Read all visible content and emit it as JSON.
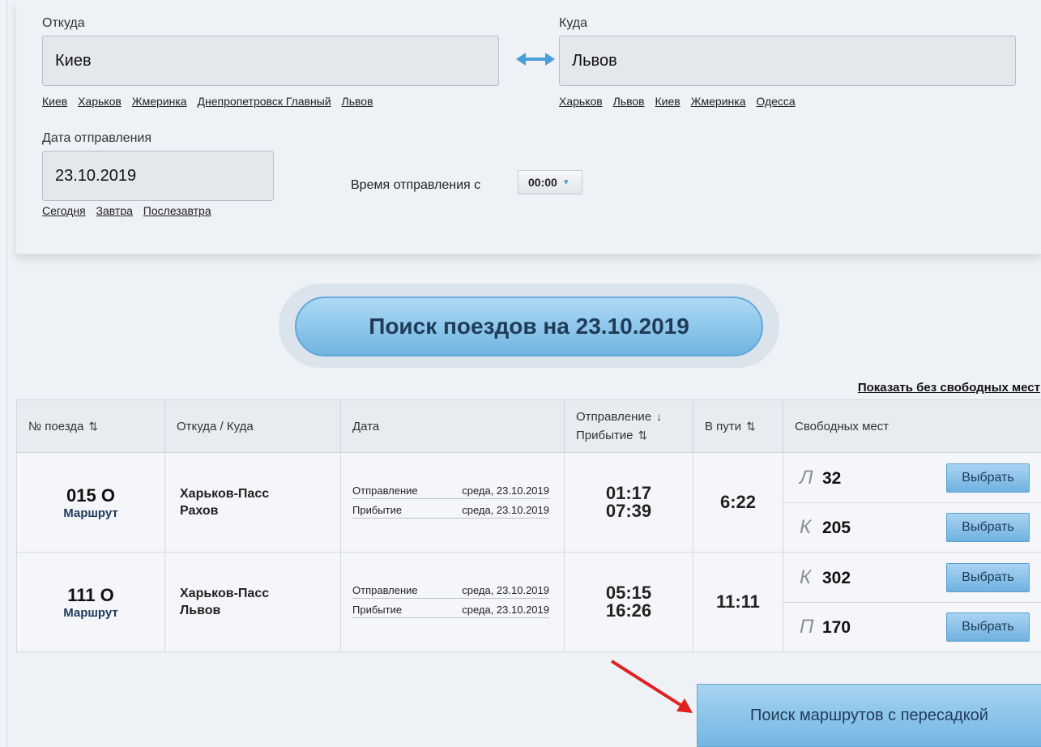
{
  "from": {
    "label": "Откуда",
    "value": "Киев",
    "quick_links": [
      "Киев",
      "Харьков",
      "Жмеринка",
      "Днепропетровск Главный",
      "Львов"
    ]
  },
  "to": {
    "label": "Куда",
    "value": "Львов",
    "quick_links": [
      "Харьков",
      "Львов",
      "Киев",
      "Жмеринка",
      "Одесса"
    ]
  },
  "date": {
    "label": "Дата отправления",
    "value": "23.10.2019",
    "quick_links": [
      "Сегодня",
      "Завтра",
      "Послезавтра"
    ]
  },
  "time": {
    "label": "Время отправления с",
    "value": "00:00"
  },
  "search_button": "Поиск поездов на 23.10.2019",
  "show_without_free": "Показать без свободных мест",
  "table": {
    "headers": {
      "train": "№ поезда",
      "route": "Откуда / Куда",
      "date": "Дата",
      "departure": "Отправление",
      "arrival": "Прибытие",
      "duration": "В пути",
      "seats": "Свободных мест"
    },
    "rows": [
      {
        "train": "015 О",
        "route_link": "Маршрут",
        "from": "Харьков-Пасс",
        "to": "Рахов",
        "dep_label": "Отправление",
        "dep_date": "среда, 23.10.2019",
        "arr_label": "Прибытие",
        "arr_date": "среда, 23.10.2019",
        "dep_time": "01:17",
        "arr_time": "07:39",
        "duration": "6:22",
        "seats": [
          {
            "type": "Л",
            "count": "32",
            "button": "Выбрать"
          },
          {
            "type": "К",
            "count": "205",
            "button": "Выбрать"
          }
        ]
      },
      {
        "train": "111 О",
        "route_link": "Маршрут",
        "from": "Харьков-Пасс",
        "to": "Львов",
        "dep_label": "Отправление",
        "dep_date": "среда, 23.10.2019",
        "arr_label": "Прибытие",
        "arr_date": "среда, 23.10.2019",
        "dep_time": "05:15",
        "arr_time": "16:26",
        "duration": "11:11",
        "seats": [
          {
            "type": "К",
            "count": "302",
            "button": "Выбрать"
          },
          {
            "type": "П",
            "count": "170",
            "button": "Выбрать"
          }
        ]
      }
    ]
  },
  "transfer_button": "Поиск маршрутов с пересадкой",
  "colors": {
    "accent_blue": "#6fb4e0",
    "arrow_red": "#e02020",
    "swap_icon": "#4a9fd8"
  }
}
